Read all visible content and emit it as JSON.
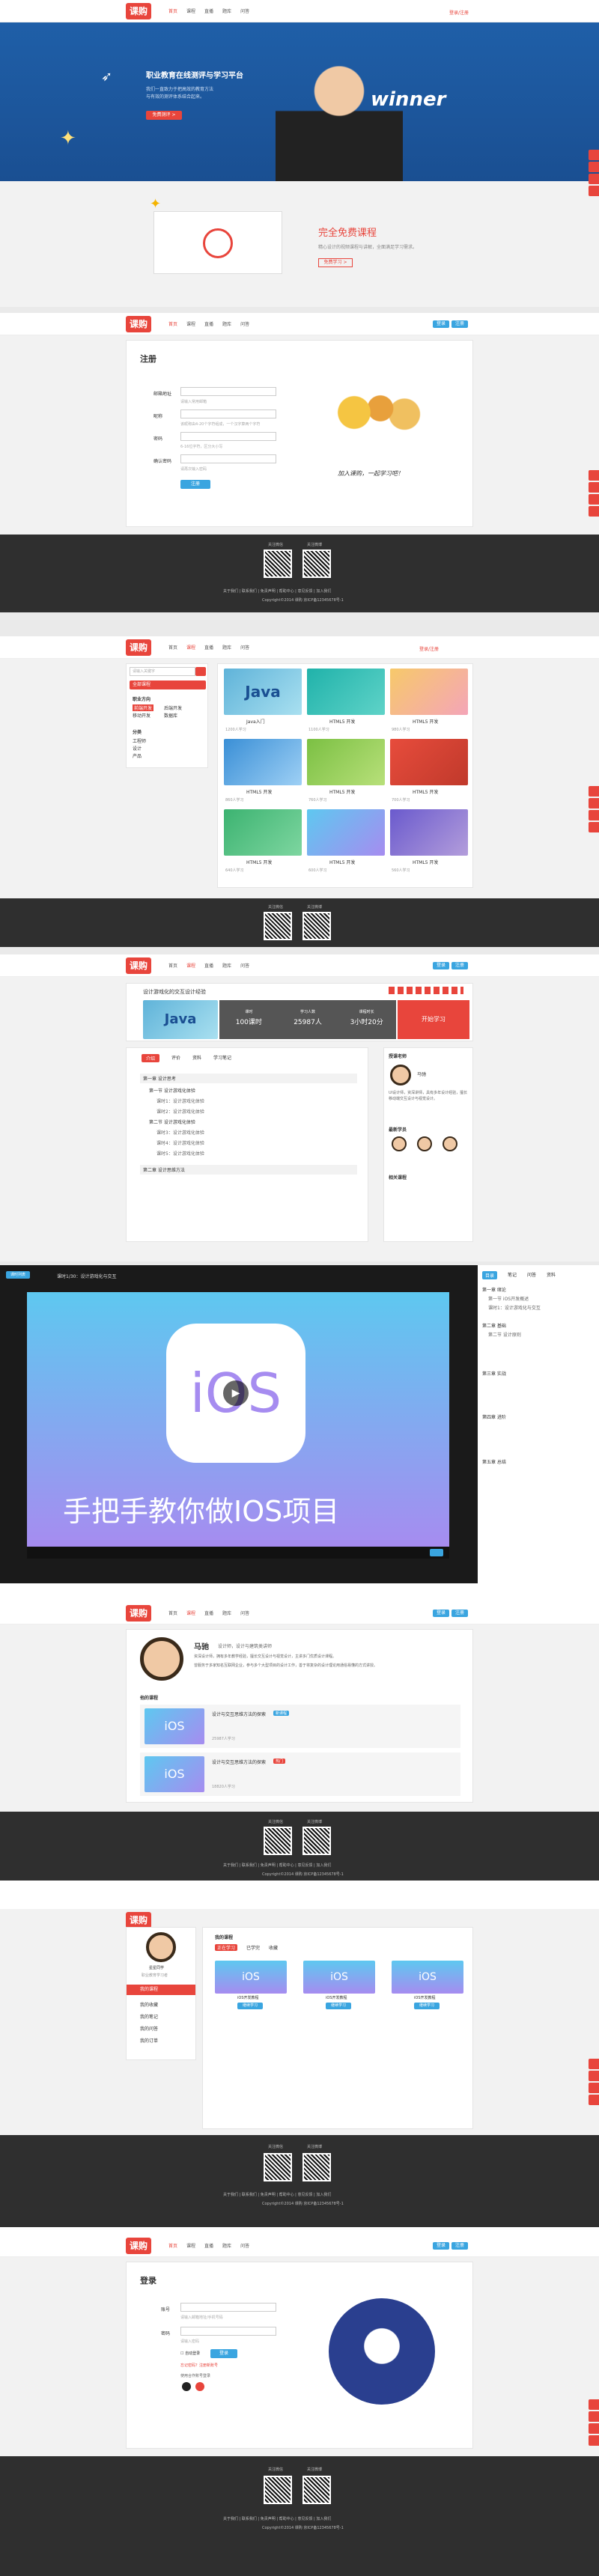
{
  "common": {
    "logo": "课购",
    "nav": [
      "首页",
      "课程",
      "直播",
      "题库",
      "问答"
    ],
    "login_link": "登录",
    "register_link": "注册",
    "footer": {
      "qr_labels": [
        "关注微信",
        "关注微博"
      ],
      "links": "关于我们 | 联系我们 | 免责声明 | 帮助中心 | 意见反馈 | 加入我们",
      "copyright": "Copyright©2014 课购 京ICP备12345678号-1"
    },
    "accent": "#e8453c",
    "blue": "#3aa5e0"
  },
  "home": {
    "hero_title": "职业教育在线测评与学习平台",
    "hero_line1": "我们一直致力于把高效的教育方法",
    "hero_line2": "与有效的测评体系结合起来。",
    "hero_button": "免费测评 >",
    "hero_word": "winner",
    "free_title": "完全免费课程",
    "free_desc": "精心设计的视频课程与讲解，全面满足学习需求。",
    "free_button": "免费学习 >"
  },
  "register": {
    "title": "注册",
    "fields": [
      {
        "label": "邮箱地址",
        "hint": "请输入常用邮箱"
      },
      {
        "label": "昵称",
        "hint": "该昵称由4-20个字符组成，一个汉字算两个字符"
      },
      {
        "label": "密码",
        "hint": "6-16位字符，区分大小写"
      },
      {
        "label": "确认密码",
        "hint": "请再次输入密码"
      }
    ],
    "button": "注册",
    "slogan": "加入课购，一起学习吧！"
  },
  "list": {
    "search_placeholder": "请输入关键字",
    "category_title": "全部课程",
    "filter_groups": [
      {
        "title": "职业方向",
        "items": [
          "前端开发",
          "后端开发",
          "移动开发",
          "数据库"
        ]
      },
      {
        "title": "分类",
        "items": [
          "工程师",
          "设计",
          "产品"
        ]
      }
    ],
    "pager": "上一页 1 2 3 下一页",
    "courses": [
      {
        "title": "Java入门",
        "meta": "1200人学习"
      },
      {
        "title": "HTML5 开发",
        "meta": "1100人学习"
      },
      {
        "title": "HTML5 开发",
        "meta": "980人学习"
      },
      {
        "title": "HTML5 开发",
        "meta": "860人学习"
      },
      {
        "title": "HTML5 开发",
        "meta": "760人学习"
      },
      {
        "title": "HTML5 开发",
        "meta": "700人学习"
      },
      {
        "title": "HTML5 开发",
        "meta": "640人学习"
      },
      {
        "title": "HTML5 开发",
        "meta": "600人学习"
      },
      {
        "title": "HTML5 开发",
        "meta": "560人学习"
      }
    ]
  },
  "detail": {
    "course_title": "设计游戏化的交互设计经验",
    "stats": [
      {
        "label": "课时",
        "value": "100课时"
      },
      {
        "label": "学习人数",
        "value": "25987人"
      },
      {
        "label": "课程时长",
        "value": "3小时20分"
      }
    ],
    "learn_button": "开始学习",
    "tabs": [
      "介绍",
      "评价",
      "资料",
      "学习笔记"
    ],
    "chapters": [
      "第一章 设计思考",
      "第一节 设计游戏化体验",
      "课时1：设计游戏化体验",
      "课时2：设计游戏化体验",
      "第二节 设计游戏化体验",
      "课时3：设计游戏化体验",
      "课时4：设计游戏化体验",
      "课时5：设计游戏化体验",
      "第二章 设计思维方法"
    ],
    "teacher_title": "授课老师",
    "teacher_name": "马驰",
    "teacher_desc": "UI设计师，资深讲师，具有多年设计经验，擅长移动端交互设计与视觉设计。",
    "students_title": "最新学员",
    "related_title": "相关课程"
  },
  "player": {
    "badge": "课时列表",
    "title": "课时1/30：设计游戏化与交互",
    "video_caption": "手把手教你做IOS项目",
    "side_tabs": [
      "目录",
      "笔记",
      "问答",
      "资料"
    ],
    "side_items": [
      "第一章 绪论",
      "第一节 iOS开发概述",
      "课时1：设计游戏化与交互",
      "第二章 基础",
      "第二节 设计原则",
      "第三章 实战",
      "第四章 进阶",
      "第五章 总结"
    ]
  },
  "teacher": {
    "name": "马驰",
    "role": "设计师，设计与建筑类讲师",
    "desc1": "资深设计师，拥有多年教学经验，擅长交互设计与视觉设计，主讲多门优质设计课程。",
    "desc2": "曾服务于多家知名互联网企业，参与多个大型项目的设计工作，善于将复杂的设计理论用通俗易懂的方式讲授。",
    "courses_title": "他的课程",
    "courses": [
      {
        "title": "设计与交互思维方法的探索",
        "tag": "新课程",
        "meta": "25987人学习"
      },
      {
        "title": "设计与交互思维方法的探索",
        "tag": "热门",
        "meta": "18820人学习"
      }
    ]
  },
  "usercenter": {
    "username": "星星同学",
    "desc": "职业教育学习者",
    "menu": [
      "我的课程",
      "我的收藏",
      "我的笔记",
      "我的问答",
      "我的订单"
    ],
    "section": "我的课程",
    "tabs": [
      "正在学习",
      "已学完",
      "收藏"
    ],
    "cards": [
      {
        "title": "iOS开发教程",
        "button": "继续学习"
      },
      {
        "title": "iOS开发教程",
        "button": "继续学习"
      },
      {
        "title": "iOS开发教程",
        "button": "继续学习"
      }
    ]
  },
  "login": {
    "title": "登录",
    "user_label": "账号",
    "user_hint": "请输入邮箱地址/手机号码",
    "pass_label": "密码",
    "pass_hint": "请输入密码",
    "remember": "自动登录",
    "button": "登录",
    "links": "忘记密码？注册新账号",
    "third_party": "使用合作账号登录"
  }
}
